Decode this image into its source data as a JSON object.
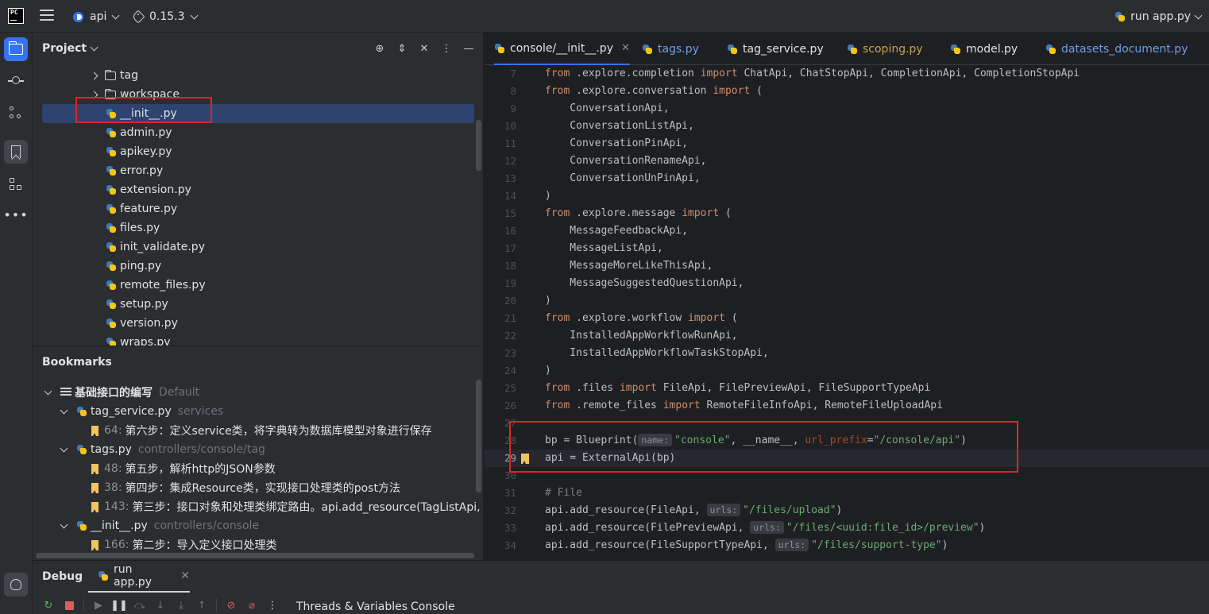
{
  "titlebar": {
    "project": "api",
    "version": "0.15.3",
    "run_config": "run app.py"
  },
  "project_panel": {
    "title": "Project",
    "tree": [
      {
        "label": "tag",
        "type": "folder"
      },
      {
        "label": "workspace",
        "type": "folder"
      },
      {
        "label": "__init__.py",
        "type": "py",
        "selected": true
      },
      {
        "label": "admin.py",
        "type": "py"
      },
      {
        "label": "apikey.py",
        "type": "py"
      },
      {
        "label": "error.py",
        "type": "py"
      },
      {
        "label": "extension.py",
        "type": "py"
      },
      {
        "label": "feature.py",
        "type": "py"
      },
      {
        "label": "files.py",
        "type": "py"
      },
      {
        "label": "init_validate.py",
        "type": "py"
      },
      {
        "label": "ping.py",
        "type": "py"
      },
      {
        "label": "remote_files.py",
        "type": "py"
      },
      {
        "label": "setup.py",
        "type": "py"
      },
      {
        "label": "version.py",
        "type": "py"
      },
      {
        "label": "wraps.py",
        "type": "py"
      }
    ]
  },
  "bookmarks_panel": {
    "title": "Bookmarks",
    "group": {
      "label": "基础接口的编写",
      "tag": "Default"
    },
    "files": [
      {
        "name": "tag_service.py",
        "path": "services",
        "items": [
          {
            "line": "64:",
            "text": "第六步：定义service类，将字典转为数据库模型对象进行保存"
          }
        ]
      },
      {
        "name": "tags.py",
        "path": "controllers/console/tag",
        "items": [
          {
            "line": "48:",
            "text": "第五步，解析http的JSON参数"
          },
          {
            "line": "38:",
            "text": "第四步：集成Resource类，实现接口处理类的post方法"
          },
          {
            "line": "143:",
            "text": "第三步：接口对象和处理类绑定路由。api.add_resource(TagListApi, \"/tags\")"
          }
        ]
      },
      {
        "name": "__init__.py",
        "path": "controllers/console",
        "items": [
          {
            "line": "166:",
            "text": "第二步：导入定义接口处理类"
          }
        ]
      }
    ]
  },
  "editor": {
    "tabs": [
      {
        "label": "console/__init__.py",
        "active": true,
        "color": "#dfe1e5"
      },
      {
        "label": "tags.py",
        "color": "#6e9fea"
      },
      {
        "label": "tag_service.py",
        "color": "#dfe1e5"
      },
      {
        "label": "scoping.py",
        "color": "#c9a34a"
      },
      {
        "label": "model.py",
        "color": "#dfe1e5"
      },
      {
        "label": "datasets_document.py",
        "color": "#6e9fea"
      }
    ],
    "line_numbers": [
      "7",
      "8",
      "9",
      "10",
      "11",
      "12",
      "13",
      "14",
      "15",
      "16",
      "17",
      "18",
      "19",
      "20",
      "21",
      "22",
      "23",
      "24",
      "25",
      "26",
      "27",
      "28",
      "29",
      "30",
      "31",
      "32",
      "33",
      "34"
    ],
    "bookmarked_line": "29",
    "hints": {
      "name": "name:",
      "urls": "urls:"
    },
    "code": {
      "l7_a": "from",
      "l7_b": " .explore.completion ",
      "l7_c": "import",
      "l7_d": " ChatApi, ChatStopApi, CompletionApi, CompletionStopApi",
      "l8_a": "from",
      "l8_b": " .explore.conversation ",
      "l8_c": "import",
      "l8_d": " (",
      "l9": "    ConversationApi,",
      "l10": "    ConversationListApi,",
      "l11": "    ConversationPinApi,",
      "l12": "    ConversationRenameApi,",
      "l13": "    ConversationUnPinApi,",
      "l14": ")",
      "l15_a": "from",
      "l15_b": " .explore.message ",
      "l15_c": "import",
      "l15_d": " (",
      "l16": "    MessageFeedbackApi,",
      "l17": "    MessageListApi,",
      "l18": "    MessageMoreLikeThisApi,",
      "l19": "    MessageSuggestedQuestionApi,",
      "l20": ")",
      "l21_a": "from",
      "l21_b": " .explore.workflow ",
      "l21_c": "import",
      "l21_d": " (",
      "l22": "    InstalledAppWorkflowRunApi,",
      "l23": "    InstalledAppWorkflowTaskStopApi,",
      "l24": ")",
      "l25_a": "from",
      "l25_b": " .files ",
      "l25_c": "import",
      "l25_d": " FileApi, FilePreviewApi, FileSupportTypeApi",
      "l26_a": "from",
      "l26_b": " .remote_files ",
      "l26_c": "import",
      "l26_d": " RemoteFileInfoApi, RemoteFileUploadApi",
      "l28_a": "bp = Blueprint(",
      "l28_s1": "\"console\"",
      "l28_b": ", __name__, ",
      "l28_k": "url_prefix",
      "l28_c": "=",
      "l28_s2": "\"/console/api\"",
      "l28_d": ")",
      "l29": "api = ExternalApi(bp)",
      "l31": "# File",
      "l32_a": "api.add_resource(FileApi, ",
      "l32_s": "\"/files/upload\"",
      "l32_b": ")",
      "l33_a": "api.add_resource(FilePreviewApi, ",
      "l33_s": "\"/files/<uuid:file_id>/preview\"",
      "l33_b": ")",
      "l34_a": "api.add_resource(FileSupportTypeApi, ",
      "l34_s": "\"/files/support-type\"",
      "l34_b": ")"
    }
  },
  "debug_panel": {
    "title": "Debug",
    "tab": "run app.py",
    "subtabs": [
      "Threads & Variables",
      "Console"
    ]
  },
  "colors": {
    "accent": "#3574f0",
    "highlight_box": "#e02424",
    "bookmark": "#f2c55c"
  }
}
